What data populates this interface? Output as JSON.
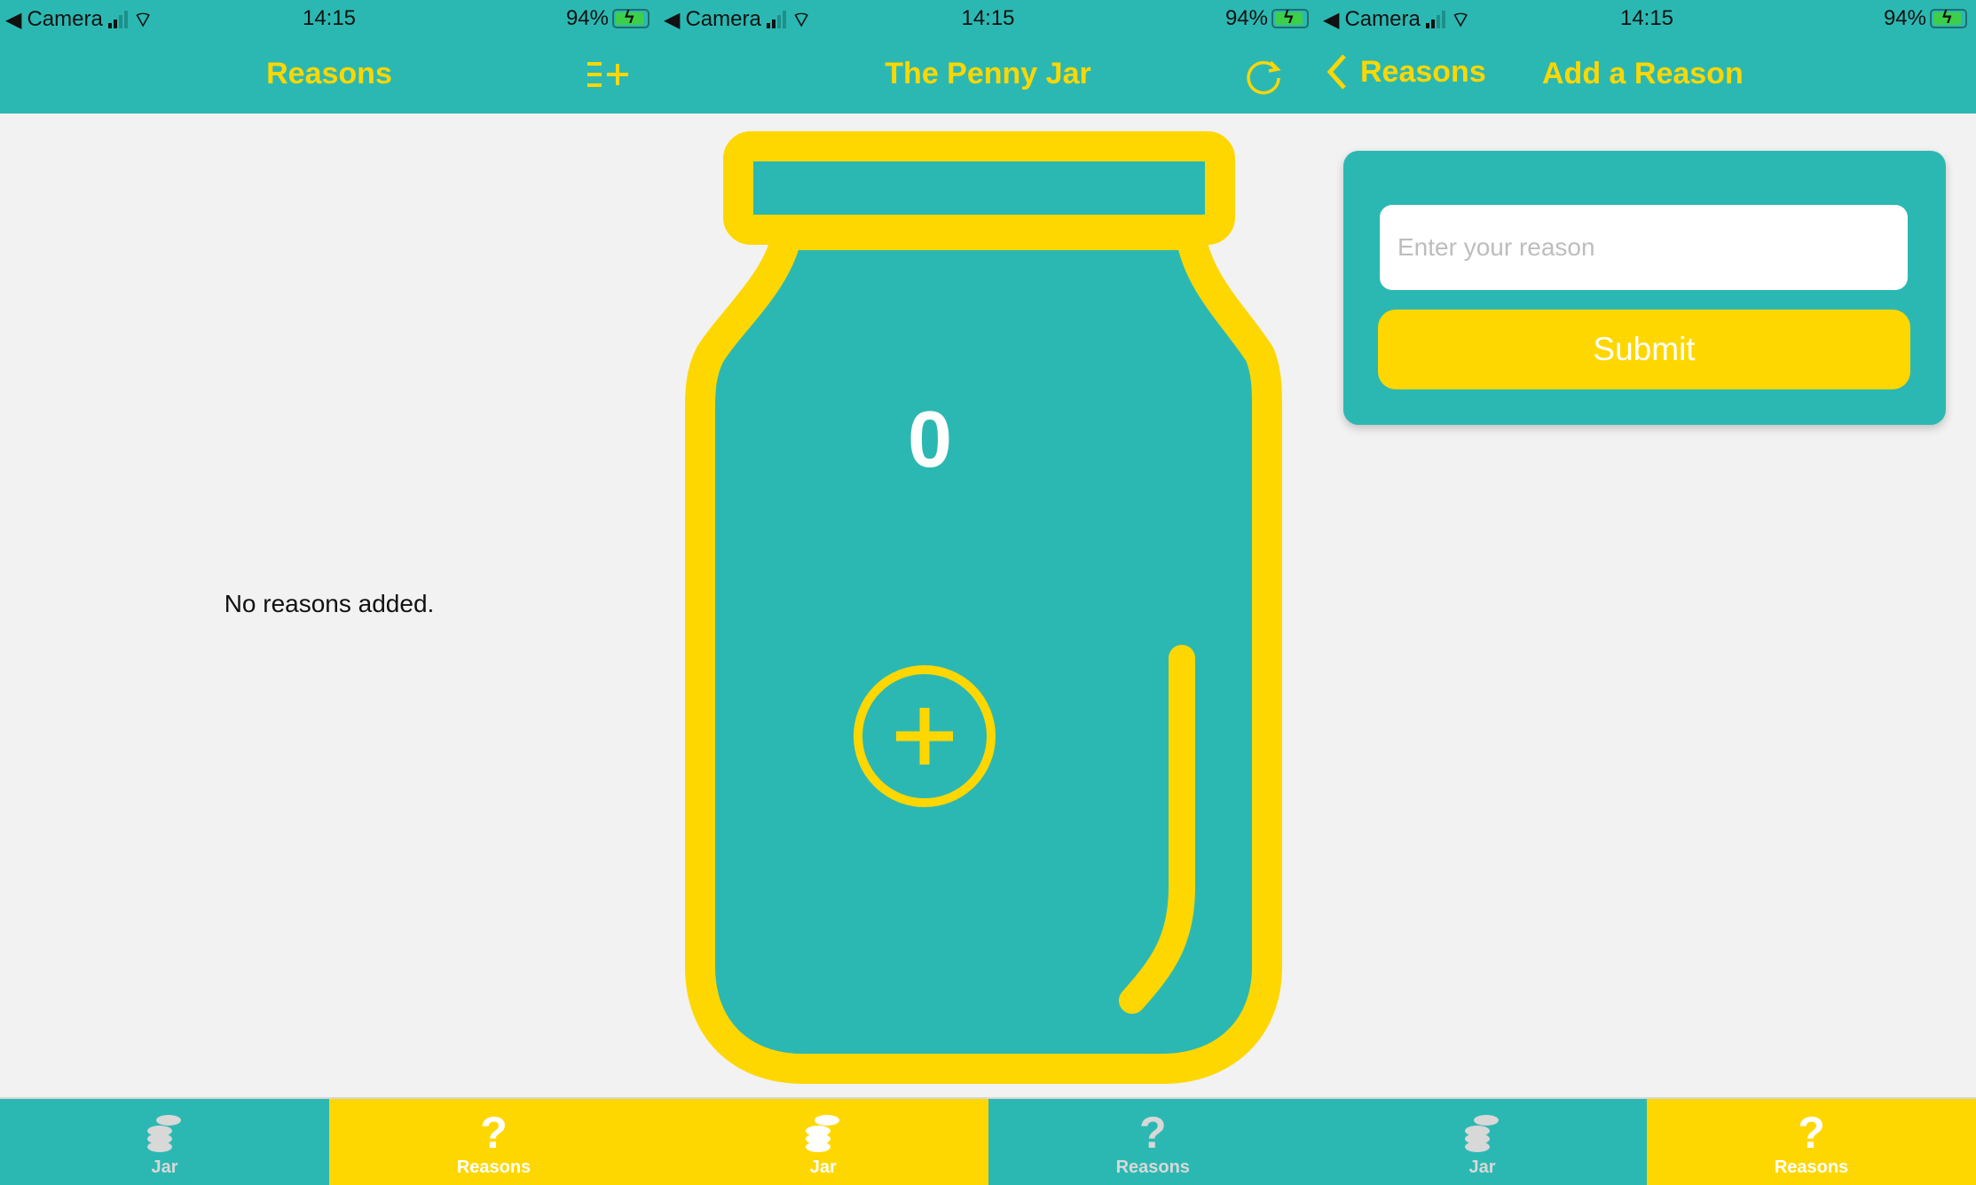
{
  "status_bar": {
    "back_app": "Camera",
    "time": "14:15",
    "battery": "94%"
  },
  "colors": {
    "teal": "#2cb8b2",
    "yellow": "#ffd700",
    "background": "#f2f2f2"
  },
  "screens": [
    {
      "title": "Reasons",
      "header_icon": "add-list-icon",
      "empty_text": "No reasons added.",
      "active_tab": "Reasons"
    },
    {
      "title": "The Penny Jar",
      "header_icon": "refresh-icon",
      "count": "0",
      "add_icon": "plus-circle-icon",
      "active_tab": "Jar"
    },
    {
      "title": "Add a Reason",
      "back_label": "Reasons",
      "input_placeholder": "Enter your reason",
      "input_value": "",
      "submit_label": "Submit",
      "active_tab": "Reasons"
    }
  ],
  "tabs": [
    {
      "label": "Jar",
      "icon": "coins-icon"
    },
    {
      "label": "Reasons",
      "icon": "question-icon"
    }
  ]
}
